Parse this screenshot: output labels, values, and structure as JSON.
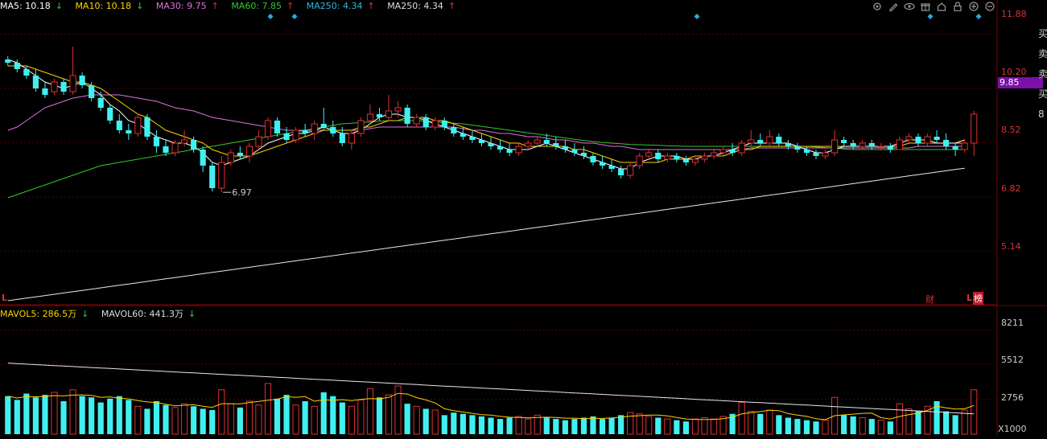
{
  "ma_legend": [
    {
      "label": "MA5: 10.18",
      "arrow": "↓",
      "color": "#ffffff",
      "arrow_color": "#2ec84a"
    },
    {
      "label": "MA10: 10.18",
      "arrow": "↓",
      "color": "#ffd200",
      "arrow_color": "#2ec84a"
    },
    {
      "label": "MA30: 9.75",
      "arrow": "↑",
      "color": "#e070e0",
      "arrow_color": "#e03030"
    },
    {
      "label": "MA60: 7.85",
      "arrow": "↑",
      "color": "#30c830",
      "arrow_color": "#e03030"
    },
    {
      "label": "MA250: 4.34",
      "arrow": "↑",
      "color": "#30b8e0",
      "arrow_color": "#e03030"
    },
    {
      "label": "MA250: 4.34",
      "arrow": "↑",
      "color": "#dddddd",
      "arrow_color": "#e03030"
    }
  ],
  "vol_legend": [
    {
      "label": "MAVOL5: 286.5万",
      "arrow": "↓",
      "color": "#ffd200",
      "arrow_color": "#2ec84a"
    },
    {
      "label": "MAVOL60: 441.3万",
      "arrow": "↓",
      "color": "#dddddd",
      "arrow_color": "#2ec84a"
    }
  ],
  "toolbar_icons": [
    "settings-icon",
    "pen-icon",
    "eye-icon",
    "gift-icon",
    "home-icon",
    "lock-icon",
    "plus-icon",
    "minus-icon"
  ],
  "price_axis": [
    "11.88",
    "10.20",
    "8.52",
    "6.82",
    "5.14"
  ],
  "current_price": "9.85",
  "volume_axis": [
    "8211",
    "5512",
    "2756"
  ],
  "volume_unit": "X1000",
  "low_marker": "6.97",
  "markers": {
    "left_L": "L",
    "right_L": "L",
    "cai": "财",
    "bang": "榜"
  },
  "right_strip": "买卖卖买8",
  "colors": {
    "up": "#e03030",
    "down": "#40f0f0",
    "grid": "#5a0000",
    "axis_text": "#e03030"
  },
  "chart_data": {
    "type": "candlestick",
    "price_ylim": [
      3.5,
      12.5
    ],
    "volume_ylim": [
      0,
      9000
    ],
    "candles": [
      [
        11.1,
        11.2,
        10.9,
        11.0,
        3000
      ],
      [
        11.0,
        11.1,
        10.7,
        10.8,
        2700
      ],
      [
        10.8,
        10.9,
        10.5,
        10.6,
        3200
      ],
      [
        10.6,
        10.8,
        10.1,
        10.2,
        2900
      ],
      [
        10.2,
        10.4,
        9.9,
        10.0,
        3100
      ],
      [
        10.1,
        10.5,
        10.0,
        10.4,
        3300
      ],
      [
        10.4,
        10.5,
        10.0,
        10.1,
        2600
      ],
      [
        10.1,
        11.5,
        10.0,
        10.6,
        3500
      ],
      [
        10.6,
        10.7,
        10.2,
        10.3,
        3000
      ],
      [
        10.3,
        10.4,
        9.8,
        9.9,
        2900
      ],
      [
        9.9,
        10.1,
        9.5,
        9.6,
        2500
      ],
      [
        9.6,
        9.7,
        9.1,
        9.2,
        2800
      ],
      [
        9.2,
        9.4,
        8.8,
        8.9,
        3000
      ],
      [
        8.9,
        9.1,
        8.6,
        8.8,
        2700
      ],
      [
        8.8,
        9.4,
        8.7,
        9.3,
        2200
      ],
      [
        9.3,
        9.4,
        8.6,
        8.7,
        2000
      ],
      [
        8.7,
        8.9,
        8.2,
        8.4,
        2600
      ],
      [
        8.4,
        8.6,
        8.1,
        8.2,
        2300
      ],
      [
        8.2,
        8.6,
        8.1,
        8.5,
        2100
      ],
      [
        8.5,
        8.9,
        8.4,
        8.6,
        2400
      ],
      [
        8.6,
        8.7,
        8.2,
        8.3,
        2200
      ],
      [
        8.3,
        8.4,
        7.6,
        7.8,
        2000
      ],
      [
        7.8,
        7.9,
        7.0,
        7.1,
        1900
      ],
      [
        7.1,
        8.1,
        6.97,
        7.9,
        3500
      ],
      [
        7.9,
        8.3,
        7.8,
        8.2,
        2400
      ],
      [
        8.2,
        8.4,
        8.0,
        8.1,
        2100
      ],
      [
        8.1,
        8.5,
        7.9,
        8.4,
        2600
      ],
      [
        8.4,
        8.9,
        8.3,
        8.7,
        2300
      ],
      [
        8.7,
        9.3,
        8.6,
        9.2,
        4000
      ],
      [
        9.2,
        9.3,
        8.7,
        8.8,
        2800
      ],
      [
        8.8,
        9.0,
        8.5,
        8.6,
        3100
      ],
      [
        8.6,
        9.0,
        8.5,
        8.9,
        2300
      ],
      [
        8.9,
        9.1,
        8.7,
        8.8,
        2600
      ],
      [
        8.8,
        9.2,
        8.6,
        9.1,
        2200
      ],
      [
        9.1,
        9.6,
        8.9,
        9.0,
        3300
      ],
      [
        9.0,
        9.2,
        8.7,
        8.8,
        3000
      ],
      [
        8.8,
        9.0,
        8.4,
        8.5,
        2500
      ],
      [
        8.5,
        8.9,
        8.3,
        8.8,
        2200
      ],
      [
        8.8,
        9.3,
        8.7,
        9.2,
        2700
      ],
      [
        9.2,
        9.7,
        9.1,
        9.4,
        3600
      ],
      [
        9.4,
        9.6,
        9.2,
        9.3,
        2900
      ],
      [
        9.3,
        10.0,
        9.2,
        9.5,
        3100
      ],
      [
        9.5,
        9.8,
        9.3,
        9.6,
        3800
      ],
      [
        9.6,
        9.7,
        9.0,
        9.1,
        2400
      ],
      [
        9.1,
        9.4,
        9.0,
        9.3,
        2200
      ],
      [
        9.3,
        9.4,
        8.9,
        9.0,
        2000
      ],
      [
        9.0,
        9.3,
        8.9,
        9.2,
        1900
      ],
      [
        9.2,
        9.3,
        8.9,
        9.0,
        1500
      ],
      [
        9.0,
        9.1,
        8.7,
        8.8,
        1700
      ],
      [
        8.8,
        9.0,
        8.6,
        8.7,
        1600
      ],
      [
        8.7,
        8.9,
        8.5,
        8.6,
        1500
      ],
      [
        8.6,
        8.8,
        8.4,
        8.5,
        1400
      ],
      [
        8.5,
        8.7,
        8.3,
        8.4,
        1300
      ],
      [
        8.4,
        8.6,
        8.2,
        8.3,
        1200
      ],
      [
        8.3,
        8.5,
        8.1,
        8.2,
        1300
      ],
      [
        8.2,
        8.5,
        8.1,
        8.4,
        1400
      ],
      [
        8.4,
        8.6,
        8.3,
        8.5,
        1200
      ],
      [
        8.5,
        8.7,
        8.4,
        8.6,
        1500
      ],
      [
        8.6,
        8.8,
        8.4,
        8.5,
        1300
      ],
      [
        8.5,
        8.7,
        8.3,
        8.4,
        1200
      ],
      [
        8.4,
        8.6,
        8.2,
        8.3,
        1100
      ],
      [
        8.3,
        8.5,
        8.1,
        8.2,
        1200
      ],
      [
        8.2,
        8.4,
        8.0,
        8.1,
        1300
      ],
      [
        8.1,
        8.2,
        7.8,
        7.9,
        1400
      ],
      [
        7.9,
        8.1,
        7.7,
        7.8,
        1200
      ],
      [
        7.8,
        8.0,
        7.6,
        7.7,
        1300
      ],
      [
        7.7,
        7.8,
        7.4,
        7.5,
        1500
      ],
      [
        7.5,
        7.9,
        7.4,
        7.8,
        1700
      ],
      [
        7.8,
        8.2,
        7.7,
        8.1,
        1600
      ],
      [
        8.1,
        8.3,
        8.0,
        8.2,
        1400
      ],
      [
        8.2,
        8.3,
        7.9,
        8.0,
        1300
      ],
      [
        8.0,
        8.2,
        7.9,
        8.1,
        1200
      ],
      [
        8.1,
        8.2,
        7.9,
        8.0,
        1100
      ],
      [
        8.0,
        8.1,
        7.8,
        7.9,
        1000
      ],
      [
        7.9,
        8.1,
        7.8,
        8.0,
        1200
      ],
      [
        8.0,
        8.2,
        7.9,
        8.1,
        1300
      ],
      [
        8.1,
        8.3,
        8.0,
        8.2,
        1200
      ],
      [
        8.2,
        8.4,
        8.1,
        8.3,
        1400
      ],
      [
        8.3,
        8.5,
        8.1,
        8.2,
        1600
      ],
      [
        8.2,
        8.6,
        8.1,
        8.5,
        2500
      ],
      [
        8.5,
        8.9,
        8.4,
        8.6,
        1800
      ],
      [
        8.6,
        8.8,
        8.4,
        8.5,
        1600
      ],
      [
        8.5,
        8.9,
        8.4,
        8.7,
        1900
      ],
      [
        8.7,
        8.8,
        8.4,
        8.5,
        1500
      ],
      [
        8.5,
        8.6,
        8.3,
        8.4,
        1300
      ],
      [
        8.4,
        8.5,
        8.2,
        8.3,
        1200
      ],
      [
        8.3,
        8.4,
        8.1,
        8.2,
        1100
      ],
      [
        8.2,
        8.3,
        8.0,
        8.1,
        1000
      ],
      [
        8.1,
        8.3,
        8.0,
        8.2,
        1100
      ],
      [
        8.2,
        8.9,
        8.1,
        8.6,
        2900
      ],
      [
        8.6,
        8.7,
        8.4,
        8.5,
        1500
      ],
      [
        8.5,
        8.6,
        8.3,
        8.4,
        1400
      ],
      [
        8.4,
        8.6,
        8.3,
        8.5,
        1300
      ],
      [
        8.5,
        8.6,
        8.3,
        8.4,
        1200
      ],
      [
        8.4,
        8.5,
        8.3,
        8.4,
        1100
      ],
      [
        8.4,
        8.5,
        8.2,
        8.3,
        1000
      ],
      [
        8.3,
        8.7,
        8.3,
        8.6,
        2400
      ],
      [
        8.6,
        8.8,
        8.5,
        8.7,
        2000
      ],
      [
        8.7,
        8.8,
        8.4,
        8.5,
        1800
      ],
      [
        8.5,
        8.8,
        8.4,
        8.7,
        2200
      ],
      [
        8.7,
        8.9,
        8.5,
        8.6,
        2600
      ],
      [
        8.6,
        8.8,
        8.3,
        8.4,
        1800
      ],
      [
        8.4,
        8.5,
        8.1,
        8.3,
        1500
      ],
      [
        8.3,
        8.6,
        8.2,
        8.5,
        1900
      ],
      [
        8.5,
        9.5,
        8.1,
        9.4,
        3500
      ]
    ],
    "ma5": [
      11.1,
      11.0,
      10.8,
      10.6,
      10.4,
      10.3,
      10.2,
      10.3,
      10.4,
      10.2,
      10.0,
      9.7,
      9.5,
      9.2,
      9.1,
      8.9,
      8.7,
      8.6,
      8.5,
      8.5,
      8.4,
      8.2,
      7.9,
      7.8,
      7.9,
      8.0,
      8.1,
      8.3,
      8.5,
      8.6,
      8.7,
      8.8,
      8.8,
      8.9,
      9.0,
      8.9,
      8.8,
      8.8,
      8.9,
      9.1,
      9.3,
      9.4,
      9.4,
      9.3,
      9.3,
      9.2,
      9.1,
      9.0,
      8.9,
      8.8,
      8.7,
      8.6,
      8.5,
      8.4,
      8.3,
      8.3,
      8.3,
      8.4,
      8.5,
      8.4,
      8.3,
      8.2,
      8.1,
      8.0,
      7.9,
      7.8,
      7.7,
      7.7,
      7.9,
      8.0,
      8.1,
      8.1,
      8.1,
      8.0,
      8.0,
      8.1,
      8.1,
      8.2,
      8.3,
      8.4,
      8.5,
      8.5,
      8.5,
      8.5,
      8.5,
      8.4,
      8.3,
      8.2,
      8.2,
      8.3,
      8.4,
      8.4,
      8.4,
      8.4,
      8.4,
      8.4,
      8.5,
      8.6,
      8.6,
      8.6,
      8.5,
      8.5,
      8.5,
      8.6
    ],
    "ma10": [
      10.9,
      10.9,
      10.9,
      10.8,
      10.7,
      10.6,
      10.5,
      10.4,
      10.4,
      10.3,
      10.2,
      10.0,
      9.8,
      9.6,
      9.4,
      9.3,
      9.1,
      8.9,
      8.8,
      8.7,
      8.6,
      8.5,
      8.3,
      8.2,
      8.1,
      8.1,
      8.1,
      8.2,
      8.3,
      8.4,
      8.5,
      8.6,
      8.7,
      8.8,
      8.9,
      8.9,
      8.9,
      8.9,
      9.0,
      9.0,
      9.1,
      9.2,
      9.2,
      9.3,
      9.3,
      9.3,
      9.2,
      9.2,
      9.1,
      9.0,
      8.9,
      8.8,
      8.7,
      8.6,
      8.5,
      8.5,
      8.4,
      8.4,
      8.4,
      8.4,
      8.4,
      8.3,
      8.3,
      8.2,
      8.1,
      8.0,
      7.9,
      7.9,
      7.9,
      7.9,
      7.9,
      8.0,
      8.0,
      8.0,
      8.1,
      8.1,
      8.1,
      8.1,
      8.2,
      8.3,
      8.3,
      8.4,
      8.4,
      8.4,
      8.4,
      8.4,
      8.4,
      8.4,
      8.4,
      8.4,
      8.4,
      8.4,
      8.4,
      8.4,
      8.4,
      8.4,
      8.4,
      8.5,
      8.5,
      8.5,
      8.5,
      8.5,
      8.5,
      8.5
    ],
    "ma30": [
      8.9,
      9.0,
      9.2,
      9.4,
      9.6,
      9.7,
      9.8,
      9.9,
      9.95,
      10.0,
      10.0,
      10.0,
      10.0,
      9.95,
      9.9,
      9.85,
      9.8,
      9.7,
      9.6,
      9.55,
      9.5,
      9.4,
      9.3,
      9.25,
      9.2,
      9.15,
      9.1,
      9.05,
      9.0,
      8.95,
      8.9,
      8.9,
      8.9,
      8.9,
      8.9,
      8.9,
      8.9,
      8.9,
      8.9,
      8.95,
      9.0,
      9.0,
      9.0,
      9.0,
      9.0,
      9.0,
      9.0,
      9.0,
      9.0,
      8.95,
      8.9,
      8.9,
      8.85,
      8.8,
      8.8,
      8.75,
      8.7,
      8.7,
      8.65,
      8.6,
      8.6,
      8.55,
      8.5,
      8.5,
      8.45,
      8.4,
      8.4,
      8.35,
      8.3,
      8.3,
      8.3,
      8.3,
      8.3,
      8.3,
      8.3,
      8.3,
      8.3,
      8.3,
      8.3,
      8.3,
      8.35,
      8.35,
      8.35,
      8.35,
      8.35,
      8.35,
      8.35,
      8.35,
      8.35,
      8.35,
      8.35,
      8.35,
      8.35,
      8.35,
      8.35,
      8.35,
      8.35,
      8.35,
      8.4,
      8.4,
      8.4,
      8.4,
      8.4,
      8.4
    ],
    "ma60": [
      6.8,
      6.9,
      7.0,
      7.1,
      7.2,
      7.3,
      7.4,
      7.5,
      7.6,
      7.7,
      7.8,
      7.85,
      7.9,
      7.95,
      8.0,
      8.05,
      8.1,
      8.15,
      8.2,
      8.25,
      8.3,
      8.35,
      8.4,
      8.45,
      8.5,
      8.55,
      8.6,
      8.65,
      8.7,
      8.75,
      8.8,
      8.85,
      8.9,
      8.95,
      9.0,
      9.05,
      9.1,
      9.12,
      9.14,
      9.16,
      9.18,
      9.2,
      9.2,
      9.2,
      9.2,
      9.18,
      9.16,
      9.14,
      9.12,
      9.1,
      9.06,
      9.02,
      8.98,
      8.94,
      8.9,
      8.86,
      8.82,
      8.78,
      8.74,
      8.7,
      8.66,
      8.62,
      8.58,
      8.55,
      8.52,
      8.5,
      8.48,
      8.46,
      8.45,
      8.44,
      8.43,
      8.42,
      8.41,
      8.4,
      8.4,
      8.4,
      8.4,
      8.4,
      8.4,
      8.4,
      8.4,
      8.4,
      8.4,
      8.4,
      8.4,
      8.4,
      8.4,
      8.38,
      8.36,
      8.34,
      8.32,
      8.3,
      8.3,
      8.3,
      8.3,
      8.3,
      8.3,
      8.3,
      8.3,
      8.3,
      8.3,
      8.3,
      8.3,
      8.3
    ],
    "ma250": [
      3.6,
      3.64,
      3.68,
      3.72,
      3.76,
      3.8,
      3.84,
      3.88,
      3.92,
      3.96,
      4.0,
      4.04,
      4.08,
      4.12,
      4.16,
      4.2,
      4.24,
      4.28,
      4.32,
      4.36,
      4.4,
      4.44,
      4.48,
      4.52,
      4.56,
      4.6,
      4.64,
      4.68,
      4.72,
      4.76,
      4.8,
      4.84,
      4.88,
      4.92,
      4.96,
      5.0,
      5.04,
      5.08,
      5.12,
      5.16,
      5.2,
      5.24,
      5.28,
      5.32,
      5.36,
      5.4,
      5.44,
      5.48,
      5.52,
      5.56,
      5.6,
      5.64,
      5.68,
      5.72,
      5.76,
      5.8,
      5.84,
      5.88,
      5.92,
      5.96,
      6.0,
      6.04,
      6.08,
      6.12,
      6.16,
      6.2,
      6.24,
      6.28,
      6.32,
      6.36,
      6.4,
      6.44,
      6.48,
      6.52,
      6.56,
      6.6,
      6.64,
      6.68,
      6.72,
      6.76,
      6.8,
      6.84,
      6.88,
      6.92,
      6.96,
      7.0,
      7.04,
      7.08,
      7.12,
      7.16,
      7.2,
      7.24,
      7.28,
      7.32,
      7.36,
      7.4,
      7.44,
      7.48,
      7.52,
      7.56,
      7.6,
      7.64,
      7.68,
      7.72
    ]
  }
}
